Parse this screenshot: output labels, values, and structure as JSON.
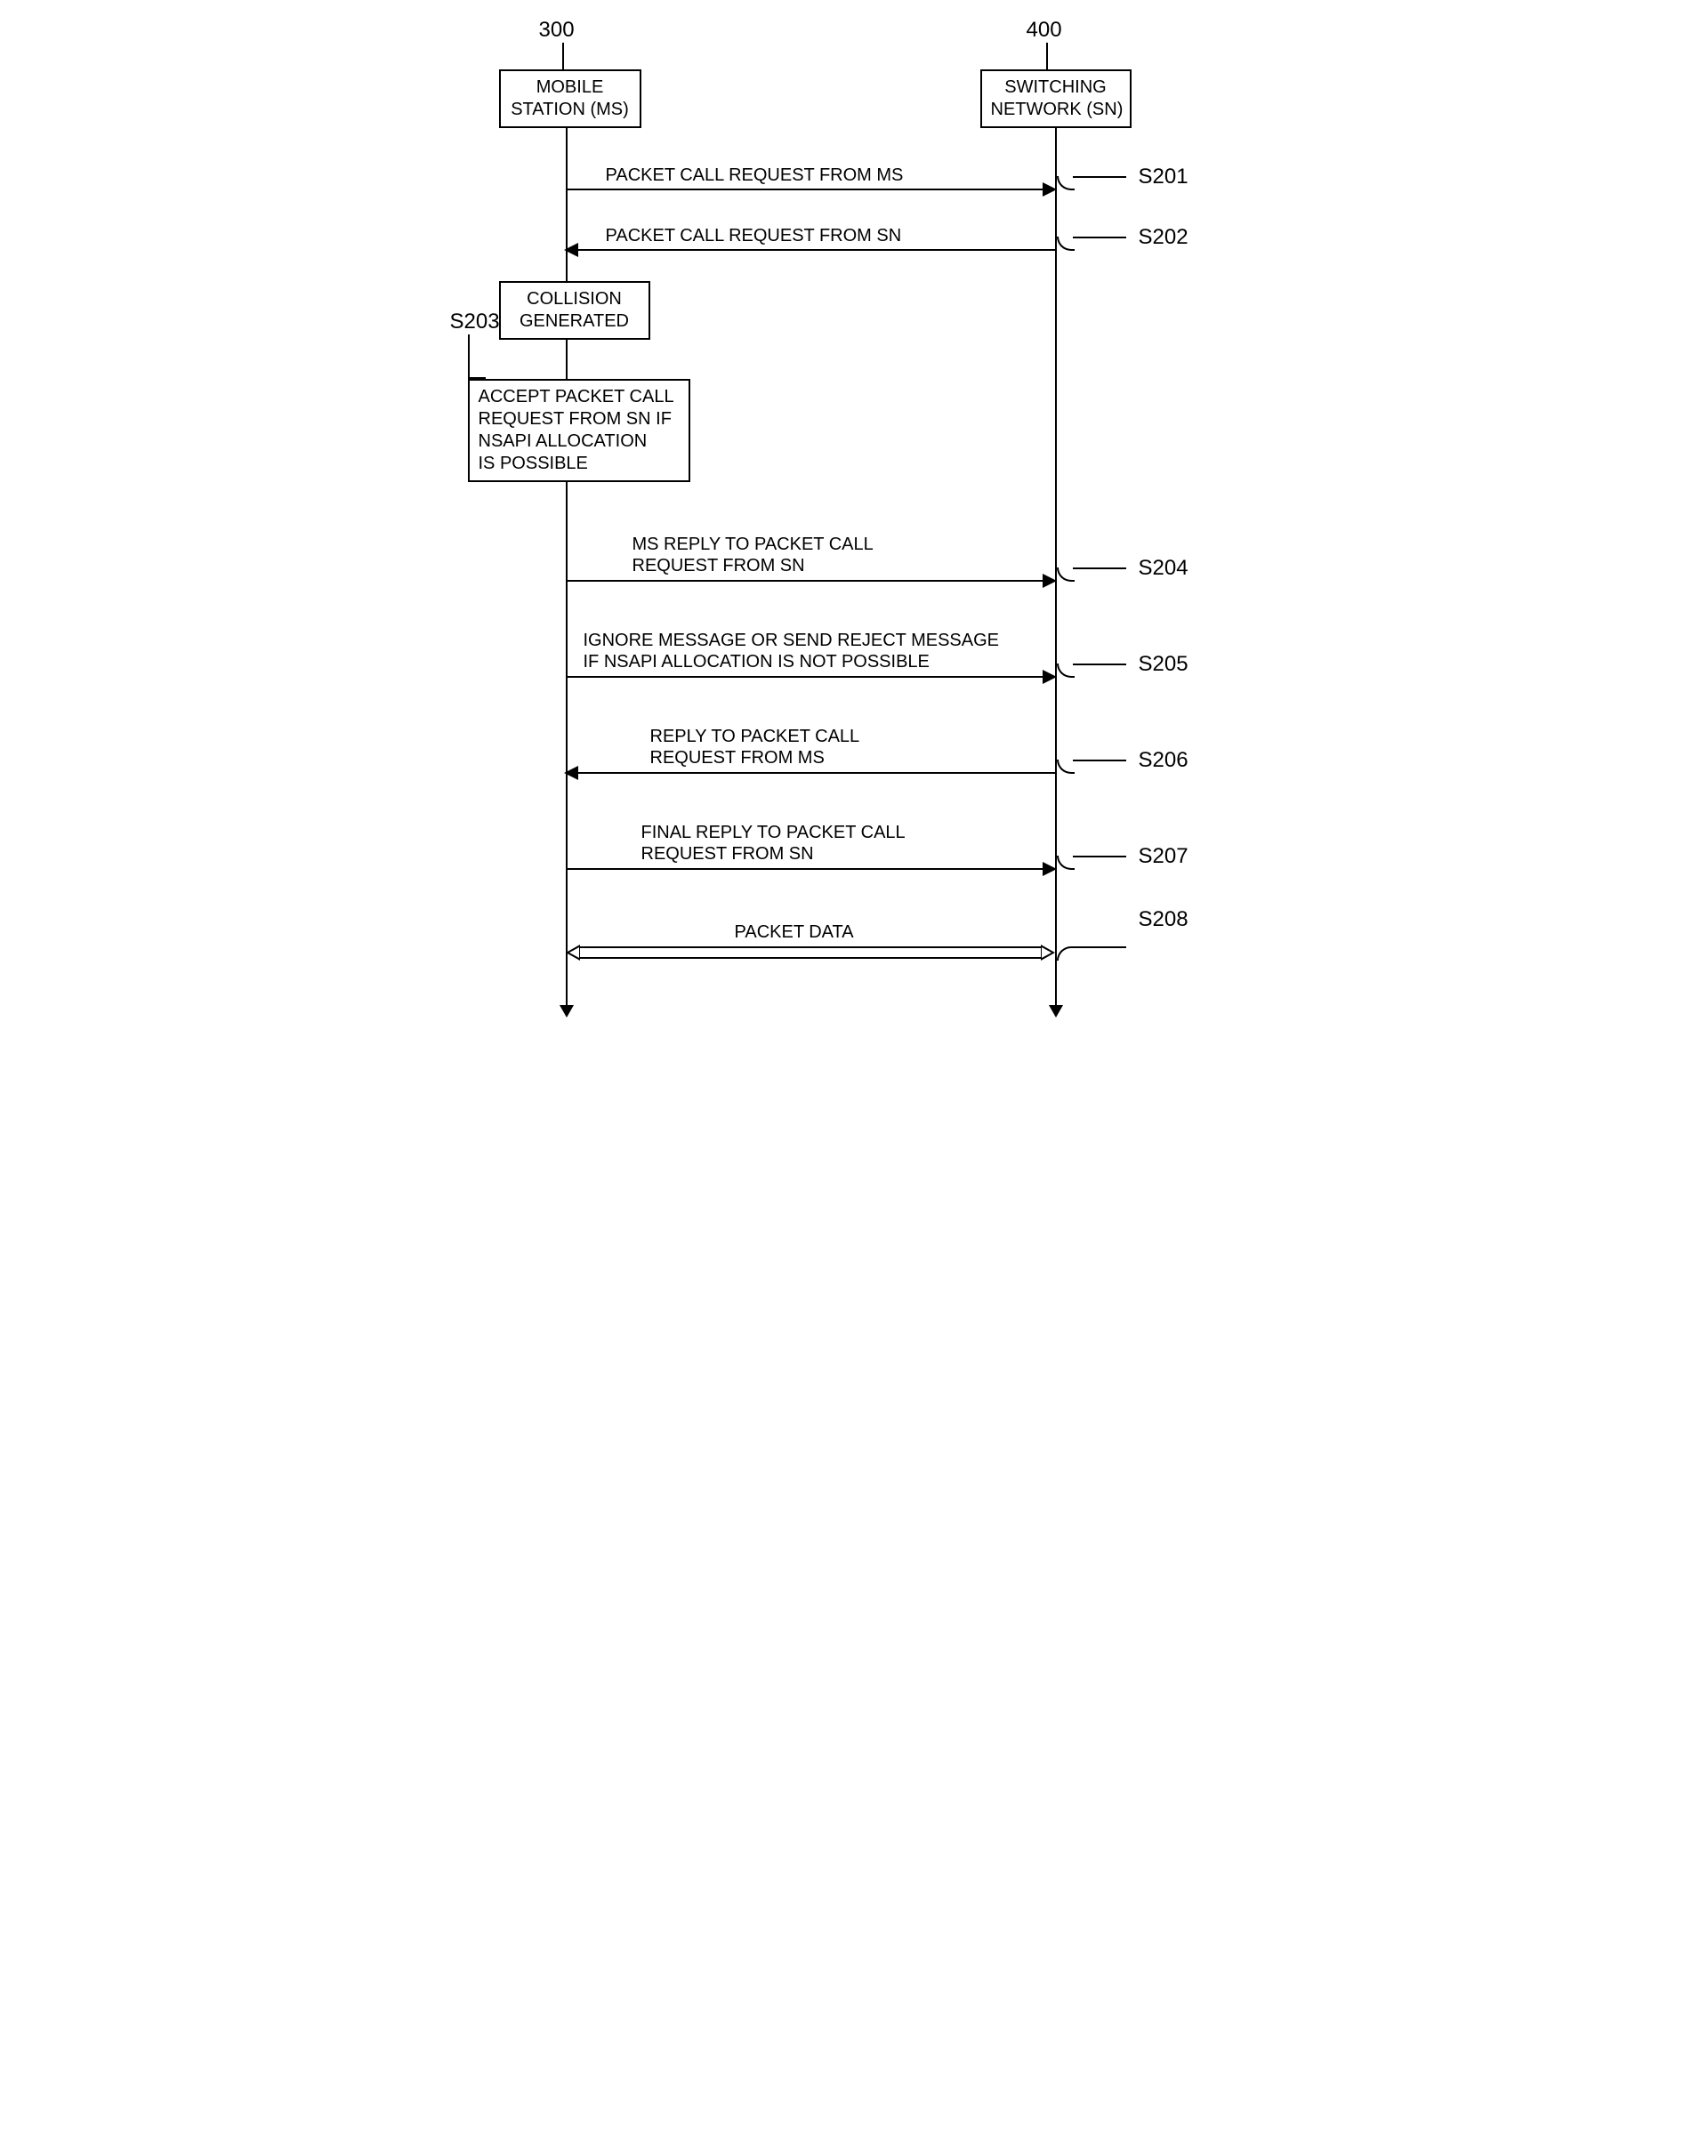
{
  "headers": {
    "ms_num": "300",
    "sn_num": "400"
  },
  "participants": {
    "ms": "MOBILE\nSTATION (MS)",
    "sn": "SWITCHING\nNETWORK (SN)"
  },
  "notes": {
    "collision": "COLLISION\nGENERATED",
    "accept": "ACCEPT PACKET CALL\nREQUEST FROM SN IF\nNSAPI ALLOCATION\nIS POSSIBLE"
  },
  "messages": {
    "s201": "PACKET CALL REQUEST FROM MS",
    "s202": "PACKET CALL REQUEST FROM SN",
    "s204": "MS REPLY TO PACKET CALL\nREQUEST FROM SN",
    "s205": "IGNORE MESSAGE OR SEND REJECT MESSAGE\nIF NSAPI ALLOCATION IS NOT POSSIBLE",
    "s206": "REPLY TO PACKET CALL\nREQUEST FROM MS",
    "s207": "FINAL REPLY TO PACKET CALL\nREQUEST FROM SN",
    "s208": "PACKET DATA"
  },
  "steps": {
    "s201": "S201",
    "s202": "S202",
    "s203": "S203",
    "s204": "S204",
    "s205": "S205",
    "s206": "S206",
    "s207": "S207",
    "s208": "S208"
  }
}
